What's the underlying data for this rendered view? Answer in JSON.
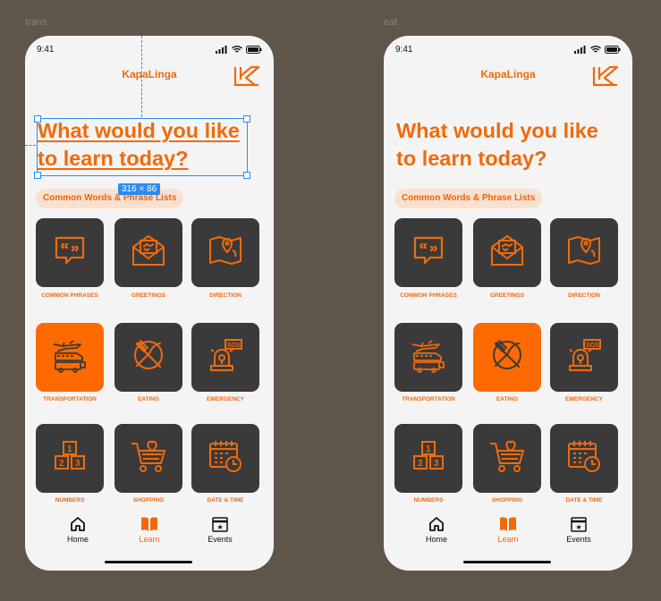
{
  "frames": [
    {
      "label": "trans",
      "active": "transportation",
      "selected": true
    },
    {
      "label": "eat",
      "active": "eating",
      "selected": false
    }
  ],
  "status_time": "9:41",
  "app_name": "KapaLinga",
  "headline": [
    "What would you like",
    "to learn today?"
  ],
  "selection_size": "316 × 86",
  "pill_label": "Common Words &  Phrase Lists",
  "tiles": [
    {
      "id": "common-phrases",
      "label": "COMMON PHRASES",
      "icon": "quote-bubble-icon"
    },
    {
      "id": "greetings",
      "label": "GREETINGS",
      "icon": "envelope-handshake-icon"
    },
    {
      "id": "direction",
      "label": "DIRECTION",
      "icon": "map-pin-icon"
    },
    {
      "id": "transportation",
      "label": "TRANSPORTATION",
      "icon": "vehicles-icon"
    },
    {
      "id": "eating",
      "label": "EATING",
      "icon": "fork-knife-plate-icon"
    },
    {
      "id": "emergency",
      "label": "EMERGENCY",
      "icon": "sos-siren-icon"
    },
    {
      "id": "numbers",
      "label": "NUMBERS",
      "icon": "number-blocks-icon"
    },
    {
      "id": "shopping",
      "label": "SHOPPING",
      "icon": "shopping-cart-icon"
    },
    {
      "id": "date-time",
      "label": "DATE & TIME",
      "icon": "calendar-clock-icon"
    }
  ],
  "nav": [
    {
      "label": "Home",
      "icon": "home-icon"
    },
    {
      "label": "Learn",
      "icon": "book-icon"
    },
    {
      "label": "Events",
      "icon": "star-calendar-icon"
    }
  ],
  "colors": {
    "accent": "#f06a0c",
    "tile": "#3a3a3a",
    "background": "#5f554b",
    "selection": "#2b8cf0"
  }
}
